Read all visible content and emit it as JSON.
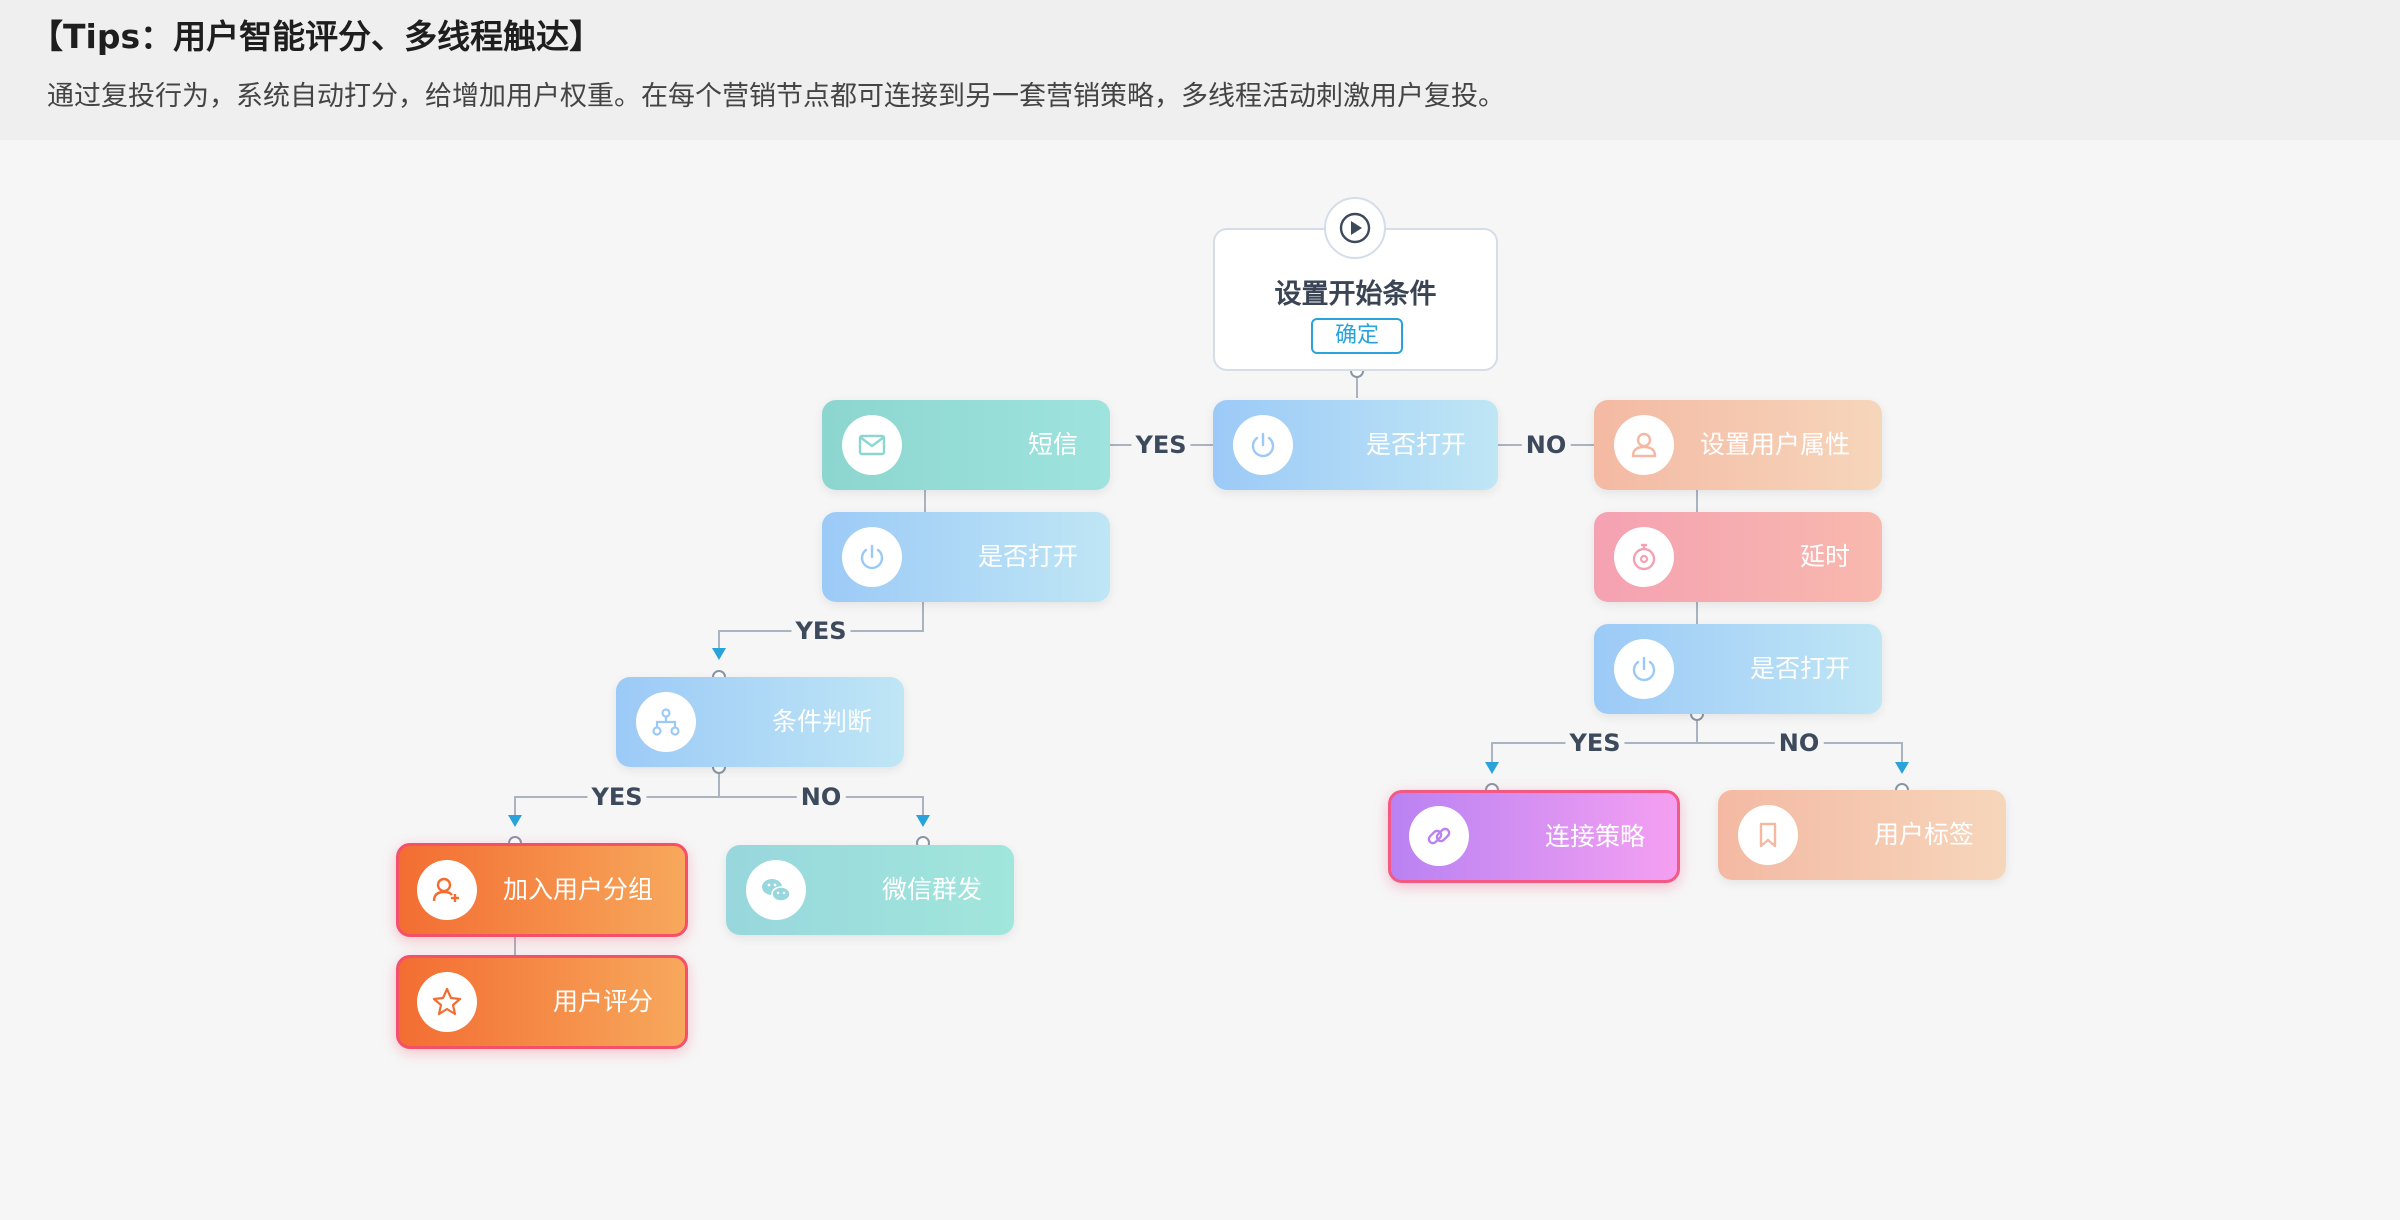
{
  "tips": {
    "title": "【Tips：用户智能评分、多线程触达】",
    "description": "通过复投行为，系统自动打分，给增加用户权重。在每个营销节点都可连接到另一套营销策略，多线程活动刺激用户复投。"
  },
  "start": {
    "title": "设置开始条件",
    "confirm": "确定"
  },
  "nodes": {
    "sms": "短信",
    "open_main": "是否打开",
    "set_attr": "设置用户属性",
    "open_left": "是否打开",
    "delay": "延时",
    "open_right": "是否打开",
    "condition": "条件判断",
    "link_strategy": "连接策略",
    "user_tag": "用户标签",
    "add_group": "加入用户分组",
    "wechat": "微信群发",
    "user_score": "用户评分"
  },
  "edge_labels": {
    "yes_sms": "YES",
    "no_attr": "NO",
    "yes_left": "YES",
    "yes_right": "YES",
    "no_right": "NO",
    "yes_cond": "YES",
    "no_cond": "NO"
  },
  "icons": {
    "start": "play-icon",
    "sms": "mail-icon",
    "open": "power-icon",
    "set_attr": "user-icon",
    "delay": "stopwatch-icon",
    "condition": "hierarchy-icon",
    "link_strategy": "link-icon",
    "user_tag": "bookmark-icon",
    "add_group": "user-add-icon",
    "wechat": "wechat-icon",
    "user_score": "star-icon"
  },
  "colors": {
    "accent": "#2aa3dc",
    "sms": "#8cd6cf",
    "open": "#9ccaf7",
    "set_attr": "#f4b9a3",
    "delay": "#f5a1b2",
    "link_strategy": "#b982f2",
    "orange": "#f36d32",
    "wechat": "#98d7dd"
  }
}
